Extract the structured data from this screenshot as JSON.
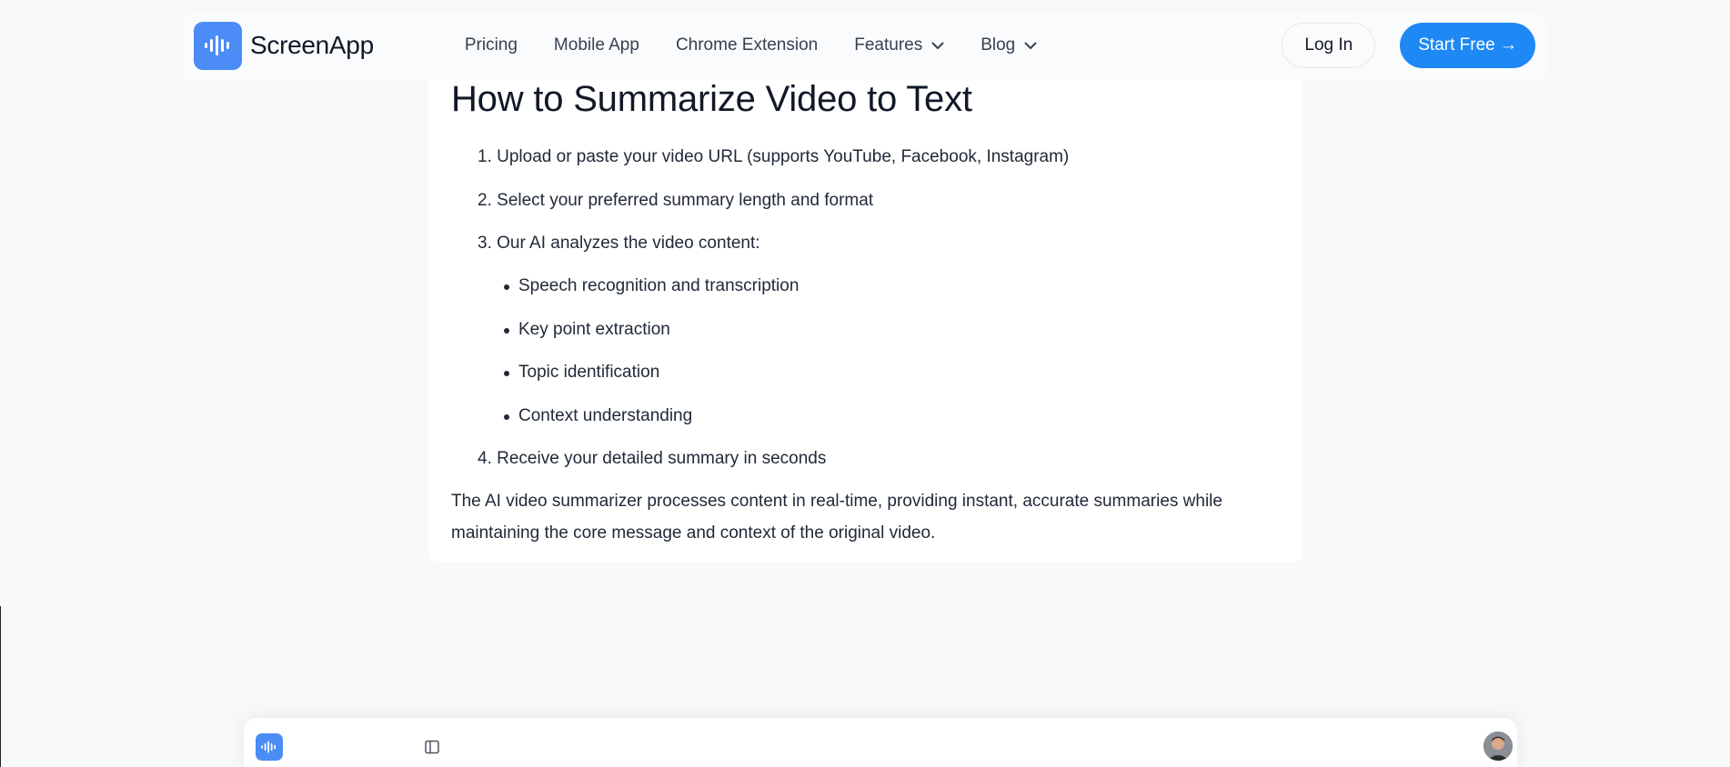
{
  "header": {
    "brand": "ScreenApp",
    "logo_icon": "waveform-icon",
    "nav": [
      {
        "label": "Pricing"
      },
      {
        "label": "Mobile App"
      },
      {
        "label": "Chrome Extension"
      },
      {
        "label": "Features",
        "icon": "chevron-down-icon"
      },
      {
        "label": "Blog",
        "icon": "chevron-down-icon"
      }
    ],
    "login_label": "Log In",
    "start_label": "Start Free →"
  },
  "article": {
    "heading": "How to Summarize Video to Text",
    "steps": [
      {
        "num": "1.",
        "text": "Upload or paste your video URL (supports YouTube, Facebook, Instagram)"
      },
      {
        "num": "2.",
        "text": "Select your preferred summary length and format"
      },
      {
        "num": "3.",
        "text": "Our AI analyzes the video content:"
      },
      {
        "num": "4.",
        "text": "Receive your detailed summary in seconds"
      }
    ],
    "sub_bullets": [
      "Speech recognition and transcription",
      "Key point extraction",
      "Topic identification",
      "Context understanding"
    ],
    "paragraph_line1": "The AI video summarizer processes content in real-time, providing instant, accurate summaries while",
    "paragraph_line2": "maintaining the core message and context of the original video."
  },
  "colors": {
    "accent": "#1e88f5",
    "logo_bg": "#4b8cf7",
    "page_bg": "#f8f9fb"
  }
}
